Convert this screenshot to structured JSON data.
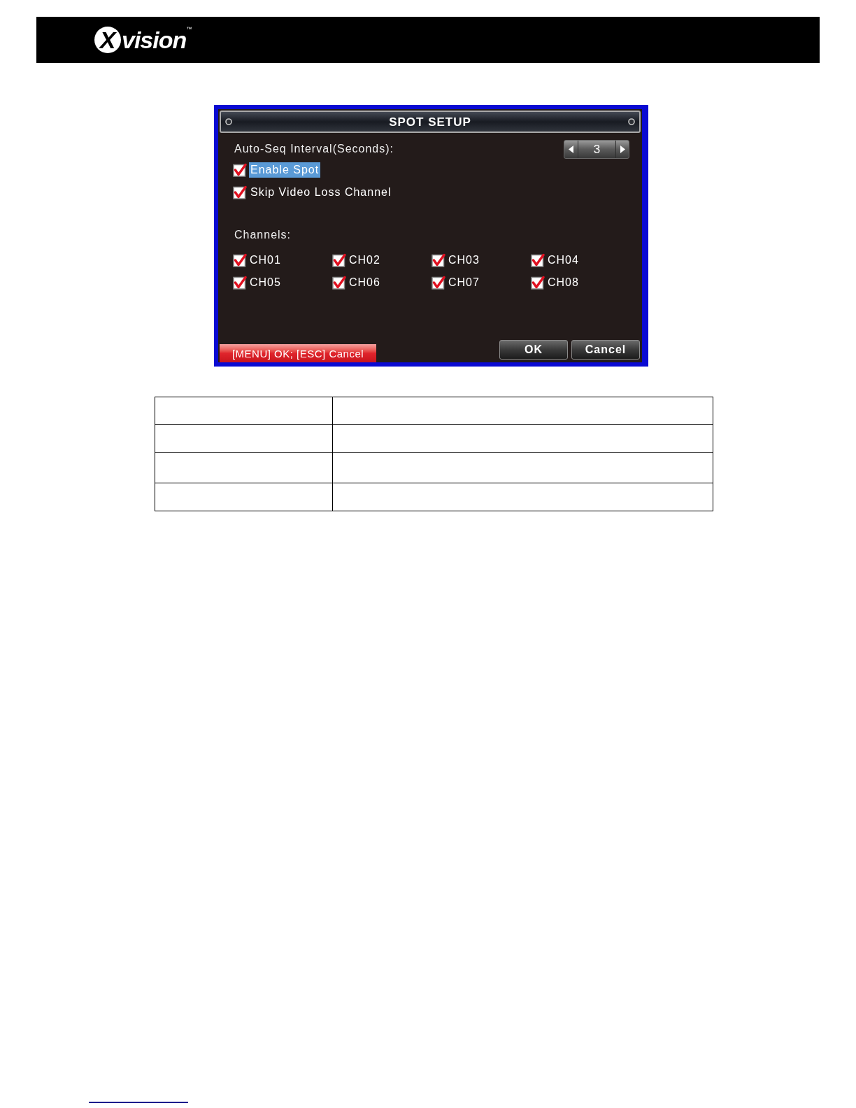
{
  "header": {
    "logo": {
      "mark": "X",
      "text": "vision",
      "trademark": "™"
    }
  },
  "dialog": {
    "title": "SPOT SETUP",
    "interval": {
      "label": "Auto-Seq Interval(Seconds):",
      "value": "3"
    },
    "options": [
      {
        "label": "Enable Spot",
        "checked": true,
        "selected": true
      },
      {
        "label": "Skip Video Loss Channel",
        "checked": true,
        "selected": false
      }
    ],
    "channels_label": "Channels:",
    "channels": [
      {
        "label": "CH01",
        "checked": true
      },
      {
        "label": "CH02",
        "checked": true
      },
      {
        "label": "CH03",
        "checked": true
      },
      {
        "label": "CH04",
        "checked": true
      },
      {
        "label": "CH05",
        "checked": true
      },
      {
        "label": "CH06",
        "checked": true
      },
      {
        "label": "CH07",
        "checked": true
      },
      {
        "label": "CH08",
        "checked": true
      }
    ],
    "hint": "[MENU] OK; [ESC] Cancel",
    "buttons": [
      {
        "label": "OK"
      },
      {
        "label": "Cancel"
      }
    ]
  }
}
